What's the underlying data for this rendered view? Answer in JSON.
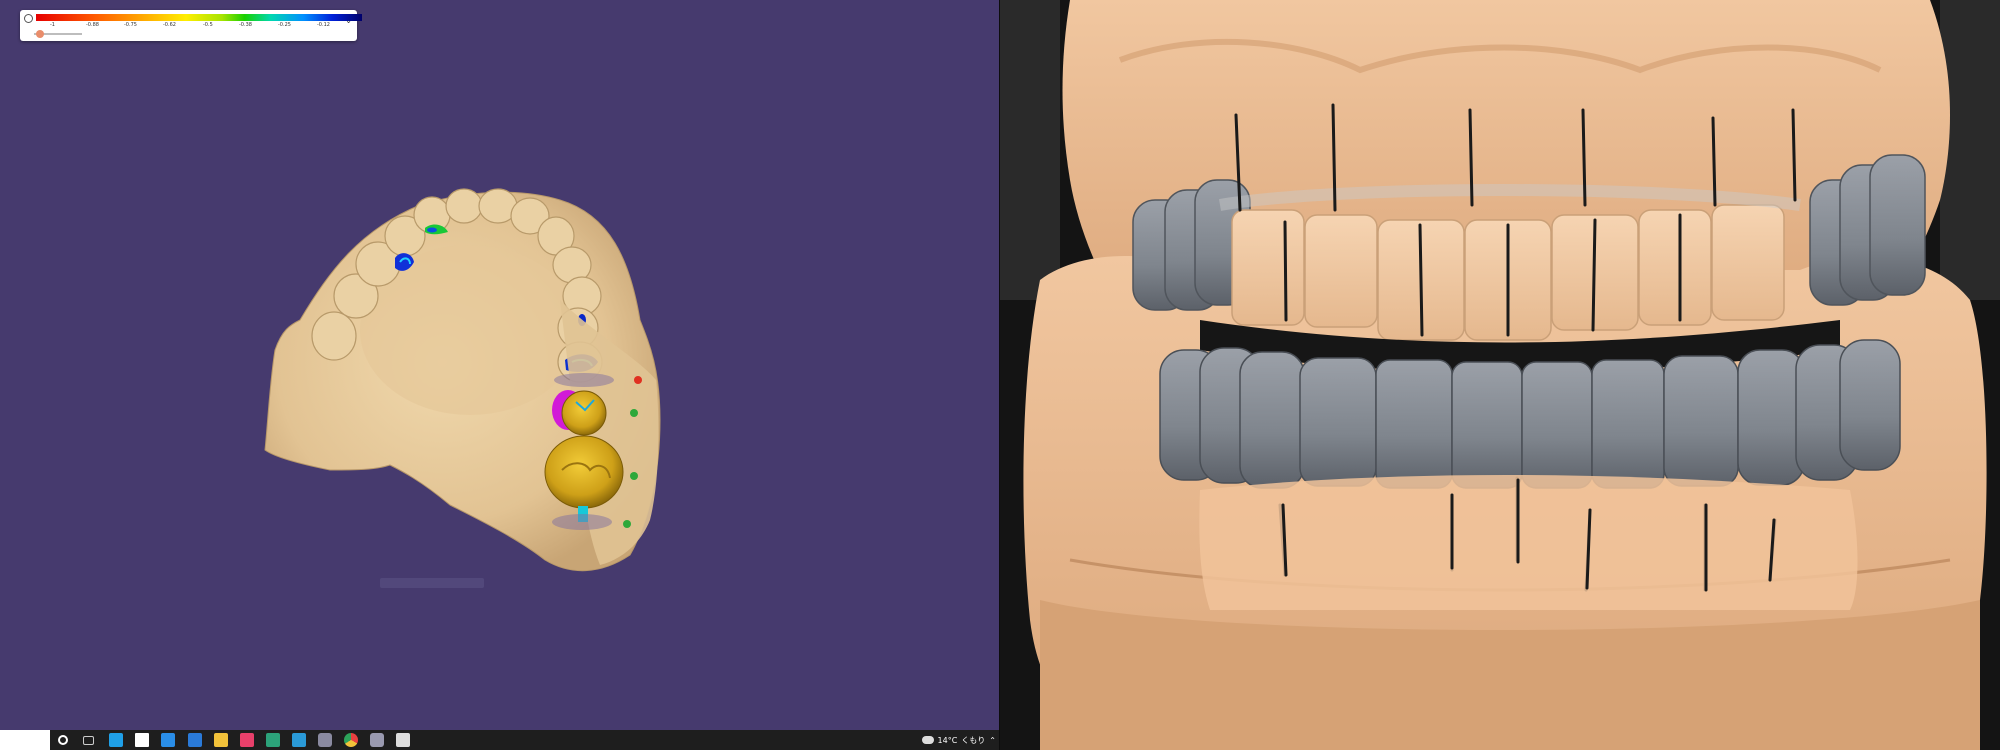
{
  "legend": {
    "ticks": [
      "-1",
      "-0.88",
      "-0.75",
      "-0.62",
      "-0.5",
      "-0.38",
      "-0.25",
      "-0.12"
    ]
  },
  "taskbar": {
    "apps": [
      {
        "icon": "cortana-icon",
        "color": "#ffffff"
      },
      {
        "icon": "task-view-icon",
        "color": "#cccccc"
      },
      {
        "icon": "edge-icon",
        "color": "#1fa0e8"
      },
      {
        "icon": "store-icon",
        "color": "#ffffff"
      },
      {
        "icon": "mail-icon",
        "color": "#2a8ee8"
      },
      {
        "icon": "app-circle-icon",
        "color": "#2a7ad8"
      },
      {
        "icon": "file-explorer-icon",
        "color": "#f2c23a"
      },
      {
        "icon": "paint-drop-icon",
        "color": "#e8406a"
      },
      {
        "icon": "image-viewer-icon",
        "color": "#2ca37a"
      },
      {
        "icon": "photos-icon",
        "color": "#2a9ad8"
      },
      {
        "icon": "dental-cad-icon",
        "color": "#8a8aa0"
      },
      {
        "icon": "chrome-icon",
        "color": "#e8b030"
      },
      {
        "icon": "dental-scan-icon",
        "color": "#9a9ab0"
      },
      {
        "icon": "cube-icon",
        "color": "#dddddd"
      }
    ],
    "weather": "14°C",
    "status": "くもり"
  },
  "colors": {
    "viewport_bg": "#463a6e",
    "model_stone": "#e8cc9e",
    "crown_gold": "#d8aa20",
    "wax_grey": "#7d848c"
  }
}
